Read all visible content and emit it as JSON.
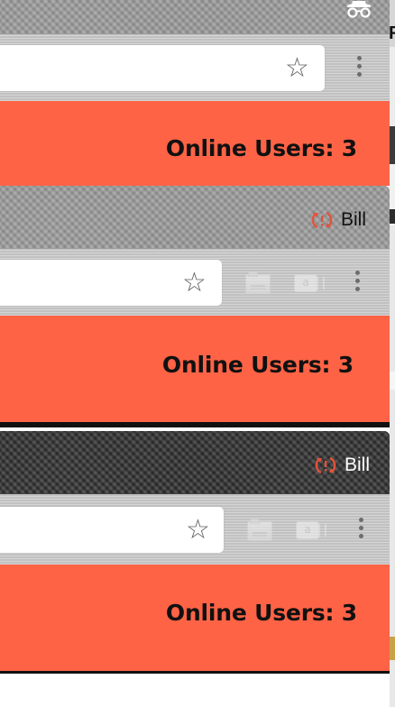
{
  "colors": {
    "panel": "#fe6346",
    "sync_icon": "#e1533c",
    "toolbar": "#c9c9c9",
    "titlebar_light": "#9a9a9a",
    "titlebar_dark": "#3d3d3d"
  },
  "windows": [
    {
      "theme": "light-carbon",
      "title_icon": "incognito-icon",
      "toolbar": {
        "bookmark_icon": "star-icon",
        "menu_icon": "menu-dots-icon"
      },
      "panel": {
        "text": "Online Users: 3"
      }
    },
    {
      "theme": "light-carbon",
      "user": {
        "name": "Bill",
        "icon": "sync-icon"
      },
      "toolbar": {
        "bookmark_icon": "star-icon",
        "extensions": [
          "book-extension-icon",
          "chat-extension-icon"
        ],
        "menu_icon": "menu-dots-icon"
      },
      "panel": {
        "text": "Online Users: 3"
      }
    },
    {
      "theme": "dark-carbon",
      "user": {
        "name": "Bill",
        "icon": "sync-icon"
      },
      "toolbar": {
        "bookmark_icon": "star-icon",
        "extensions": [
          "book-extension-icon",
          "chat-extension-icon"
        ],
        "menu_icon": "menu-dots-icon"
      },
      "panel": {
        "text": "Online Users: 3"
      }
    }
  ],
  "edge_letter": "F"
}
